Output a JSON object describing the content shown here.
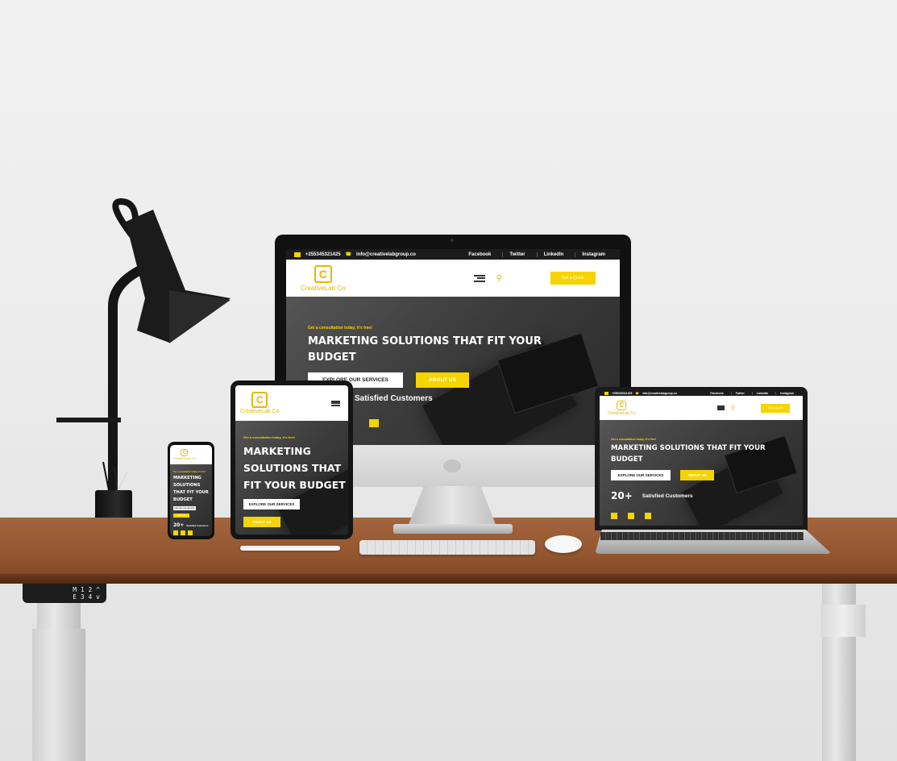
{
  "site": {
    "topbar": {
      "phone": "+255345321425",
      "email": "info@creativelabgroup.co",
      "social": [
        "Facebook",
        "Twitter",
        "LinkedIn",
        "Instagram"
      ]
    },
    "logo_mark": "C",
    "logo_text": "CreativeLab Co",
    "quote_button": "Get a Quote",
    "hero": {
      "tagline": "Get a consultation today, it's free!",
      "headline": "MARKETING SOLUTIONS THAT FIT YOUR BUDGET",
      "explore_button": "EXPLORE OUR SERVICES",
      "about_button": "ABOUT US"
    },
    "stats": {
      "number": "20+",
      "label": "Satisfied Customers"
    }
  },
  "desk_controller": {
    "row1": "M 1 2 ^",
    "row2": "E 3 4 v"
  },
  "colors": {
    "accent": "#f5d400",
    "dark": "#1c1c1c",
    "hero_bg": "#3c3c3c"
  }
}
